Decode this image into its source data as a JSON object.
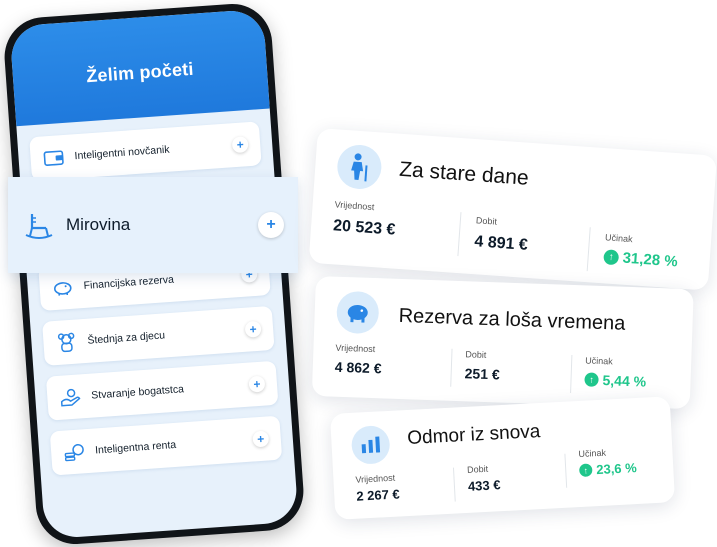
{
  "phone": {
    "title": "Želim početi",
    "items": [
      {
        "label": "Inteligentni novčanik",
        "icon": "wallet-icon"
      },
      {
        "label": "Financijska rezerva",
        "icon": "piggy-bank-icon"
      },
      {
        "label": "Štednja za djecu",
        "icon": "teddy-bear-icon"
      },
      {
        "label": "Stvaranje bogatstca",
        "icon": "money-hand-icon"
      },
      {
        "label": "Inteligentna renta",
        "icon": "coins-icon"
      }
    ],
    "plus": "+"
  },
  "highlight": {
    "label": "Mirovina",
    "icon": "rocking-chair-icon",
    "plus": "+"
  },
  "cards": [
    {
      "title": "Za stare dane",
      "icon": "elderly-person-icon",
      "value_label": "Vrijednost",
      "value": "20 523 €",
      "profit_label": "Dobit",
      "profit": "4 891 €",
      "perf_label": "Učinak",
      "perf": "31,28 %"
    },
    {
      "title": "Rezerva za loša vremena",
      "icon": "piggy-bank-icon",
      "value_label": "Vrijednost",
      "value": "4 862 €",
      "profit_label": "Dobit",
      "profit": "251 €",
      "perf_label": "Učinak",
      "perf": "5,44 %"
    },
    {
      "title": "Odmor iz snova",
      "icon": "bar-chart-icon",
      "value_label": "Vrijednost",
      "value": "2 267 €",
      "profit_label": "Dobit",
      "profit": "433 €",
      "perf_label": "Učinak",
      "perf": "23,6 %"
    }
  ],
  "colors": {
    "primary": "#2a86e5",
    "gain": "#1fc68b",
    "screen_bg": "#e7f1fb"
  }
}
